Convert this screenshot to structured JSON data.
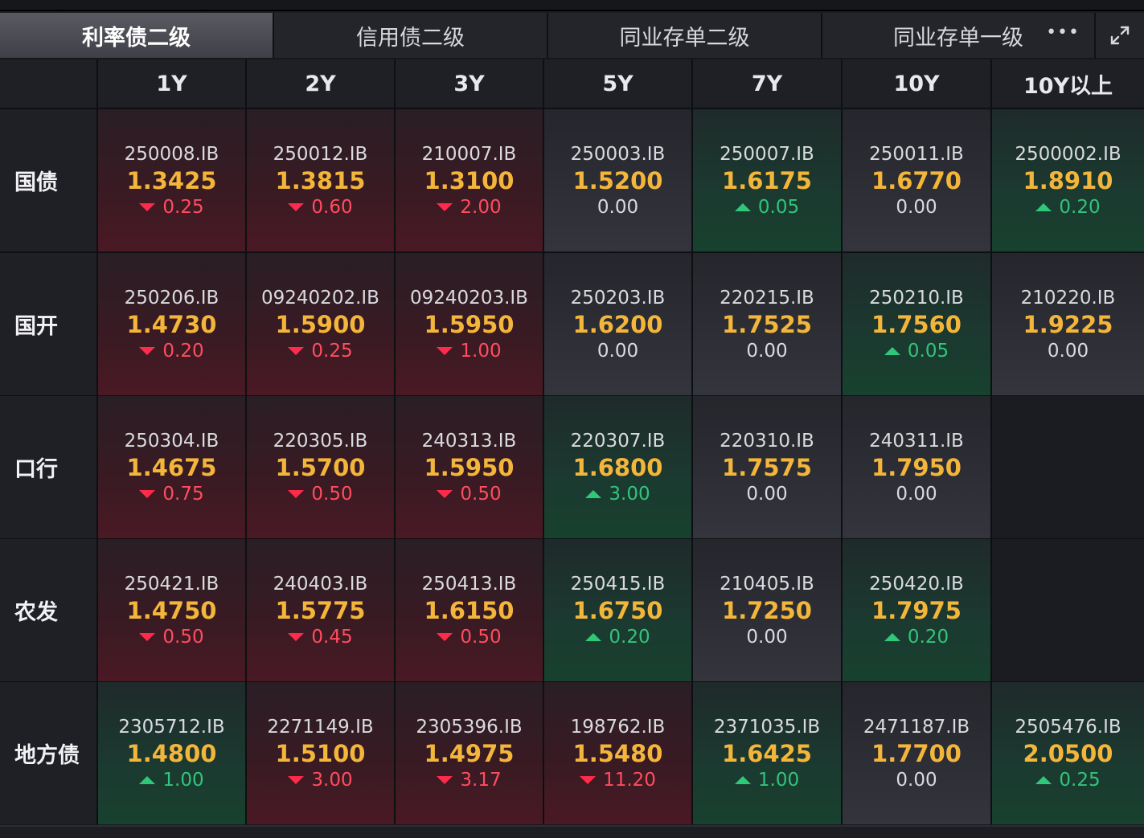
{
  "tabs": [
    {
      "label": "利率债二级",
      "active": true
    },
    {
      "label": "信用债二级",
      "active": false
    },
    {
      "label": "同业存单二级",
      "active": false
    },
    {
      "label": "同业存单一级",
      "active": false
    }
  ],
  "more_icon": "•••",
  "expand_icon": "expand-icon",
  "columns": [
    "1Y",
    "2Y",
    "3Y",
    "5Y",
    "7Y",
    "10Y",
    "10Y以上"
  ],
  "colors": {
    "yield": "#f4b63a",
    "down": "#ff4d5e",
    "up": "#33c37a"
  },
  "rows": [
    {
      "label": "国债",
      "cells": [
        {
          "code": "250008.IB",
          "yield": "1.3425",
          "change": "0.25",
          "dir": "down"
        },
        {
          "code": "250012.IB",
          "yield": "1.3815",
          "change": "0.60",
          "dir": "down"
        },
        {
          "code": "210007.IB",
          "yield": "1.3100",
          "change": "2.00",
          "dir": "down"
        },
        {
          "code": "250003.IB",
          "yield": "1.5200",
          "change": "0.00",
          "dir": "flat"
        },
        {
          "code": "250007.IB",
          "yield": "1.6175",
          "change": "0.05",
          "dir": "up"
        },
        {
          "code": "250011.IB",
          "yield": "1.6770",
          "change": "0.00",
          "dir": "flat"
        },
        {
          "code": "2500002.IB",
          "yield": "1.8910",
          "change": "0.20",
          "dir": "up"
        }
      ]
    },
    {
      "label": "国开",
      "cells": [
        {
          "code": "250206.IB",
          "yield": "1.4730",
          "change": "0.20",
          "dir": "down"
        },
        {
          "code": "09240202.IB",
          "yield": "1.5900",
          "change": "0.25",
          "dir": "down"
        },
        {
          "code": "09240203.IB",
          "yield": "1.5950",
          "change": "1.00",
          "dir": "down"
        },
        {
          "code": "250203.IB",
          "yield": "1.6200",
          "change": "0.00",
          "dir": "flat"
        },
        {
          "code": "220215.IB",
          "yield": "1.7525",
          "change": "0.00",
          "dir": "flat"
        },
        {
          "code": "250210.IB",
          "yield": "1.7560",
          "change": "0.05",
          "dir": "up"
        },
        {
          "code": "210220.IB",
          "yield": "1.9225",
          "change": "0.00",
          "dir": "flat"
        }
      ]
    },
    {
      "label": "口行",
      "cells": [
        {
          "code": "250304.IB",
          "yield": "1.4675",
          "change": "0.75",
          "dir": "down"
        },
        {
          "code": "220305.IB",
          "yield": "1.5700",
          "change": "0.50",
          "dir": "down"
        },
        {
          "code": "240313.IB",
          "yield": "1.5950",
          "change": "0.50",
          "dir": "down"
        },
        {
          "code": "220307.IB",
          "yield": "1.6800",
          "change": "3.00",
          "dir": "up"
        },
        {
          "code": "220310.IB",
          "yield": "1.7575",
          "change": "0.00",
          "dir": "flat"
        },
        {
          "code": "240311.IB",
          "yield": "1.7950",
          "change": "0.00",
          "dir": "flat"
        },
        null
      ]
    },
    {
      "label": "农发",
      "cells": [
        {
          "code": "250421.IB",
          "yield": "1.4750",
          "change": "0.50",
          "dir": "down"
        },
        {
          "code": "240403.IB",
          "yield": "1.5775",
          "change": "0.45",
          "dir": "down"
        },
        {
          "code": "250413.IB",
          "yield": "1.6150",
          "change": "0.50",
          "dir": "down"
        },
        {
          "code": "250415.IB",
          "yield": "1.6750",
          "change": "0.20",
          "dir": "up"
        },
        {
          "code": "210405.IB",
          "yield": "1.7250",
          "change": "0.00",
          "dir": "flat"
        },
        {
          "code": "250420.IB",
          "yield": "1.7975",
          "change": "0.20",
          "dir": "up"
        },
        null
      ]
    },
    {
      "label": "地方债",
      "cells": [
        {
          "code": "2305712.IB",
          "yield": "1.4800",
          "change": "1.00",
          "dir": "up"
        },
        {
          "code": "2271149.IB",
          "yield": "1.5100",
          "change": "3.00",
          "dir": "down"
        },
        {
          "code": "2305396.IB",
          "yield": "1.4975",
          "change": "3.17",
          "dir": "down"
        },
        {
          "code": "198762.IB",
          "yield": "1.5480",
          "change": "11.20",
          "dir": "down"
        },
        {
          "code": "2371035.IB",
          "yield": "1.6425",
          "change": "1.00",
          "dir": "up"
        },
        {
          "code": "2471187.IB",
          "yield": "1.7700",
          "change": "0.00",
          "dir": "flat"
        },
        {
          "code": "2505476.IB",
          "yield": "2.0500",
          "change": "0.25",
          "dir": "up"
        }
      ]
    }
  ]
}
